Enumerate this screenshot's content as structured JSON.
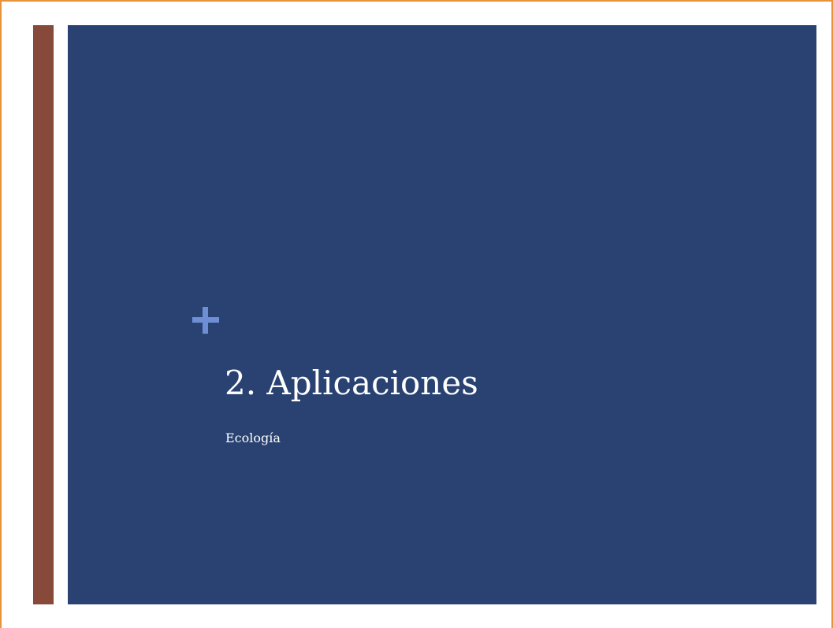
{
  "slide": {
    "title": "2. Aplicaciones",
    "subtitle": "Ecología"
  },
  "icons": {
    "plus": "plus-icon"
  },
  "colors": {
    "frame_border": "#E8923A",
    "accent_bar": "#86493A",
    "panel_background": "#294271",
    "plus_icon": "#6E8FD4",
    "text": "#FFFFFF"
  }
}
